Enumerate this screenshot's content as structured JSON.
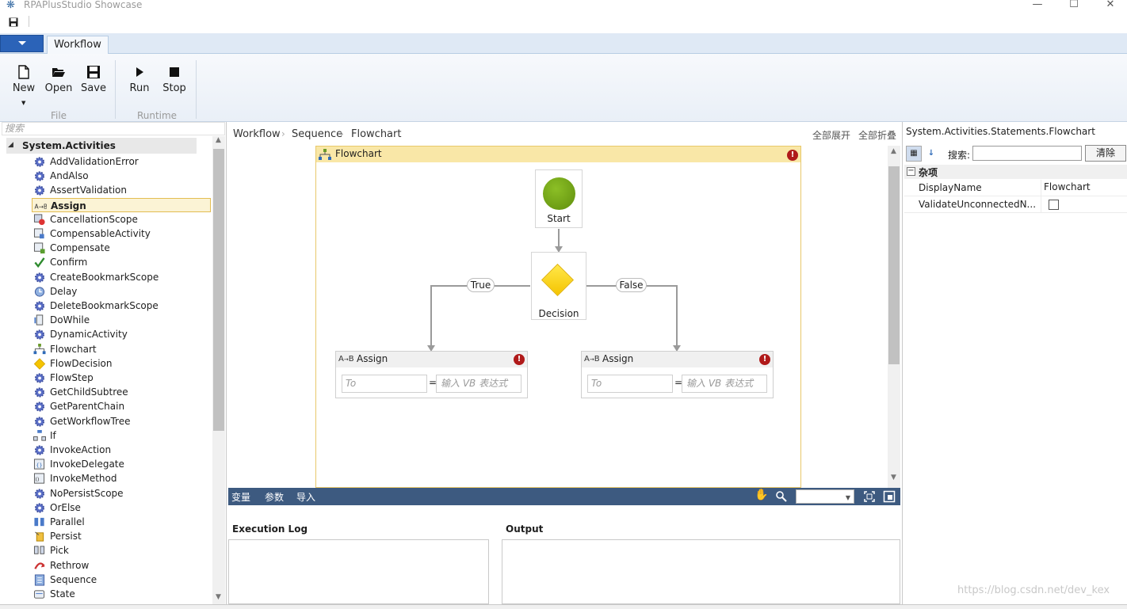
{
  "window": {
    "title": "RPAPlusStudio Showcase",
    "minimize": "—",
    "maximize": "☐",
    "close": "✕"
  },
  "ribbon": {
    "tab": "Workflow",
    "buttons": {
      "new": "New",
      "open": "Open",
      "save": "Save",
      "run": "Run",
      "stop": "Stop"
    },
    "groups": {
      "file": "File",
      "runtime": "Runtime"
    }
  },
  "toolbox": {
    "search_placeholder": "搜索",
    "root": "System.Activities",
    "items": [
      {
        "label": "AddValidationError",
        "icon": "gear-icon"
      },
      {
        "label": "AndAlso",
        "icon": "gear-icon"
      },
      {
        "label": "AssertValidation",
        "icon": "gear-icon"
      },
      {
        "label": "Assign",
        "icon": "assign-icon",
        "selected": true
      },
      {
        "label": "CancellationScope",
        "icon": "cancellation-icon"
      },
      {
        "label": "CompensableActivity",
        "icon": "compensable-icon"
      },
      {
        "label": "Compensate",
        "icon": "compensate-icon"
      },
      {
        "label": "Confirm",
        "icon": "checkmark-icon"
      },
      {
        "label": "CreateBookmarkScope",
        "icon": "gear-icon"
      },
      {
        "label": "Delay",
        "icon": "clock-icon"
      },
      {
        "label": "DeleteBookmarkScope",
        "icon": "gear-icon"
      },
      {
        "label": "DoWhile",
        "icon": "loop-icon"
      },
      {
        "label": "DynamicActivity",
        "icon": "gear-icon"
      },
      {
        "label": "Flowchart",
        "icon": "flowchart-icon"
      },
      {
        "label": "FlowDecision",
        "icon": "diamond-icon"
      },
      {
        "label": "FlowStep",
        "icon": "gear-icon"
      },
      {
        "label": "GetChildSubtree",
        "icon": "gear-icon"
      },
      {
        "label": "GetParentChain",
        "icon": "gear-icon"
      },
      {
        "label": "GetWorkflowTree",
        "icon": "gear-icon"
      },
      {
        "label": "If",
        "icon": "branch-icon"
      },
      {
        "label": "InvokeAction",
        "icon": "gear-icon"
      },
      {
        "label": "InvokeDelegate",
        "icon": "invoke-delegate-icon"
      },
      {
        "label": "InvokeMethod",
        "icon": "invoke-method-icon"
      },
      {
        "label": "NoPersistScope",
        "icon": "gear-icon"
      },
      {
        "label": "OrElse",
        "icon": "gear-icon"
      },
      {
        "label": "Parallel",
        "icon": "parallel-icon"
      },
      {
        "label": "Persist",
        "icon": "persist-icon"
      },
      {
        "label": "Pick",
        "icon": "pick-icon"
      },
      {
        "label": "Rethrow",
        "icon": "rethrow-icon"
      },
      {
        "label": "Sequence",
        "icon": "sequence-icon"
      },
      {
        "label": "State",
        "icon": "state-icon"
      }
    ]
  },
  "designer": {
    "breadcrumb": [
      "Workflow",
      "Sequence",
      "Flowchart"
    ],
    "expand_all": "全部展开",
    "collapse_all": "全部折叠",
    "flowchart_title": "Flowchart",
    "error_mark": "!",
    "start_label": "Start",
    "decision_label": "Decision",
    "true_label": "True",
    "false_label": "False",
    "assign_left": {
      "title": "Assign",
      "to_placeholder": "To",
      "eq": "=",
      "value_placeholder": "输入 VB 表达式"
    },
    "assign_right": {
      "title": "Assign",
      "to_placeholder": "To",
      "eq": "=",
      "value_placeholder": "输入 VB 表达式"
    },
    "bar_tabs": [
      "变量",
      "参数",
      "导入"
    ]
  },
  "logs": {
    "execution_title": "Execution Log",
    "output_title": "Output"
  },
  "properties": {
    "title": "System.Activities.Statements.Flowchart",
    "search_label": "搜索:",
    "clear_label": "清除",
    "category": "杂项",
    "rows": [
      {
        "name": "DisplayName",
        "value": "Flowchart"
      },
      {
        "name": "ValidateUnconnectedN...",
        "checked": false
      }
    ]
  },
  "watermark": "https://blog.csdn.net/dev_kex"
}
